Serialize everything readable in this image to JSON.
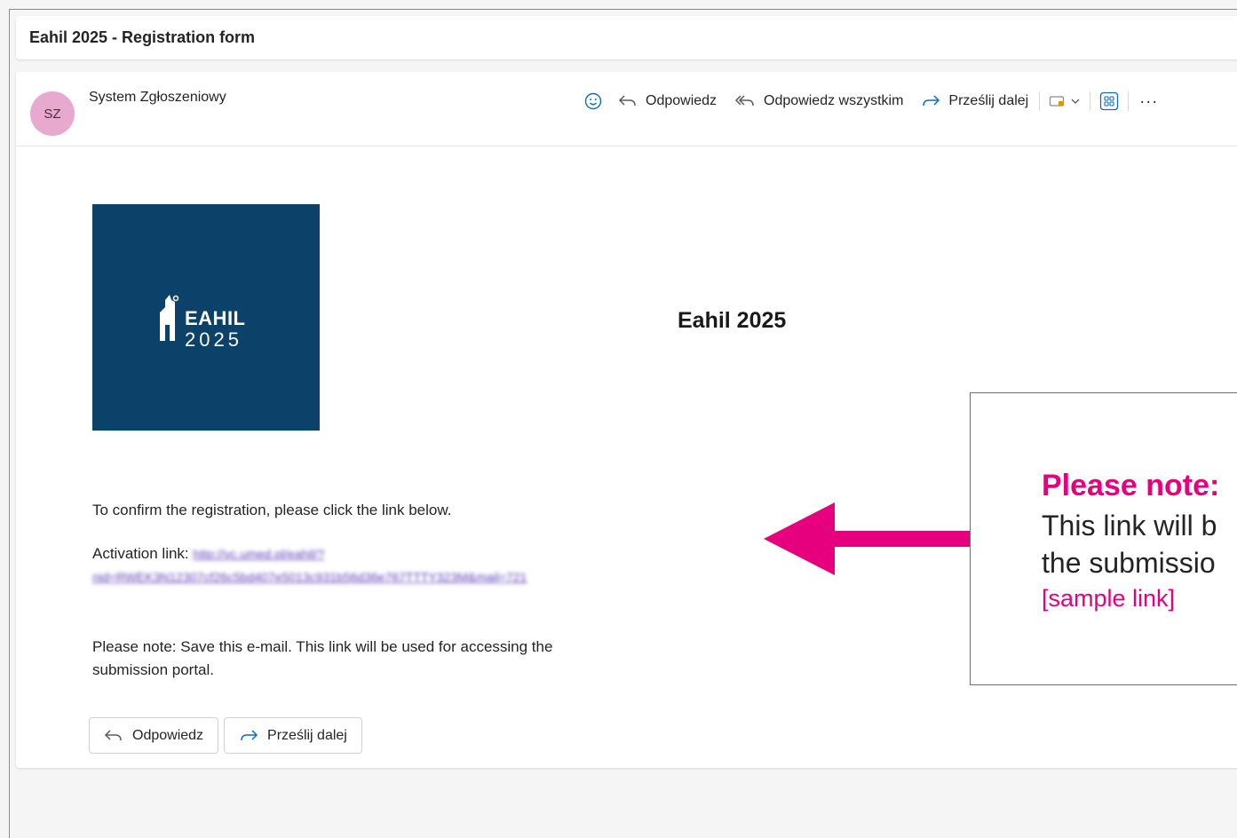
{
  "subject": "Eahil 2025 - Registration form",
  "sender": {
    "initials": "SZ",
    "name": "System Zgłoszeniowy"
  },
  "toolbar": {
    "reply_label": "Odpowiedz",
    "reply_all_label": "Odpowiedz wszystkim",
    "forward_label": "Prześlij dalej",
    "more_label": "···"
  },
  "logo": {
    "word": "EAHIL",
    "year": "2025"
  },
  "event_title": "Eahil 2025",
  "body": {
    "confirm_text": "To confirm the registration, please click the link below.",
    "activation_label": "Activation link:",
    "activation_url_line1": "http://vc.umed.pl/eahil/?",
    "activation_url_line2": "nid=RWEK3N12307cf26c5bd407e5013c931b56d36e767TTTY323M&mail=721",
    "note_line1": "Please note: Save this e-mail. This link will be used for accessing the",
    "note_line2": "submission portal."
  },
  "buttons": {
    "reply": "Odpowiedz",
    "forward": "Prześlij dalej"
  },
  "callout": {
    "title": "Please note:",
    "line1": "This link will b",
    "line2": "the submissio",
    "link": "[sample link]"
  },
  "colors": {
    "accent_pink": "#e6007e",
    "logo_blue": "#0c4169",
    "avatar_pink": "#e8a9cf"
  }
}
